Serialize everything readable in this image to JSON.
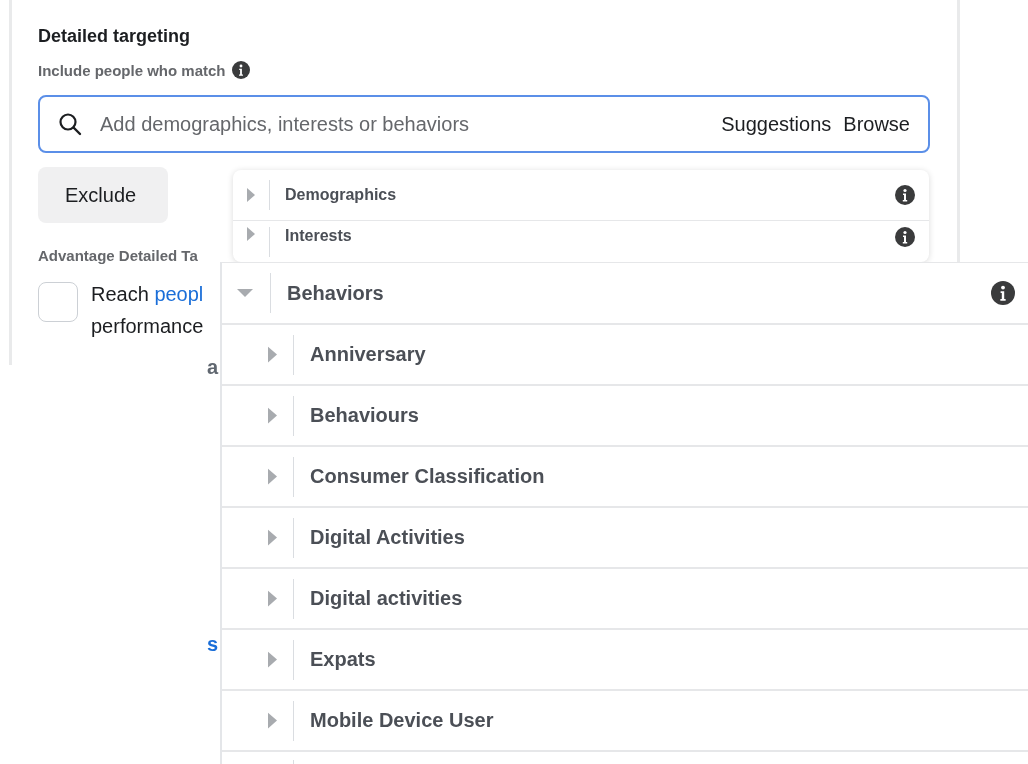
{
  "panel": {
    "title": "Detailed targeting",
    "subtitle": "Include people who match",
    "search": {
      "placeholder": "Add demographics, interests or behaviors",
      "actions": [
        "Suggestions",
        "Browse"
      ]
    },
    "exclude_button": "Exclude",
    "advantage_label": "Advantage Detailed Ta",
    "advantage_option": {
      "checked": false,
      "text_start": "Reach ",
      "link": "peopl",
      "line2": "performance"
    },
    "fragments": [
      "a",
      "s"
    ]
  },
  "browse_menu": {
    "items": [
      {
        "label": "Demographics",
        "expanded": false
      },
      {
        "label": "Interests",
        "expanded": false
      }
    ]
  },
  "behaviors_panel": {
    "header": {
      "label": "Behaviors",
      "expanded": true
    },
    "children": [
      {
        "label": "Anniversary",
        "expanded": false
      },
      {
        "label": "Behaviours",
        "expanded": false
      },
      {
        "label": "Consumer Classification",
        "expanded": false
      },
      {
        "label": "Digital Activities",
        "expanded": false
      },
      {
        "label": "Digital activities",
        "expanded": false
      },
      {
        "label": "Expats",
        "expanded": false
      },
      {
        "label": "Mobile Device User",
        "expanded": false
      }
    ]
  }
}
